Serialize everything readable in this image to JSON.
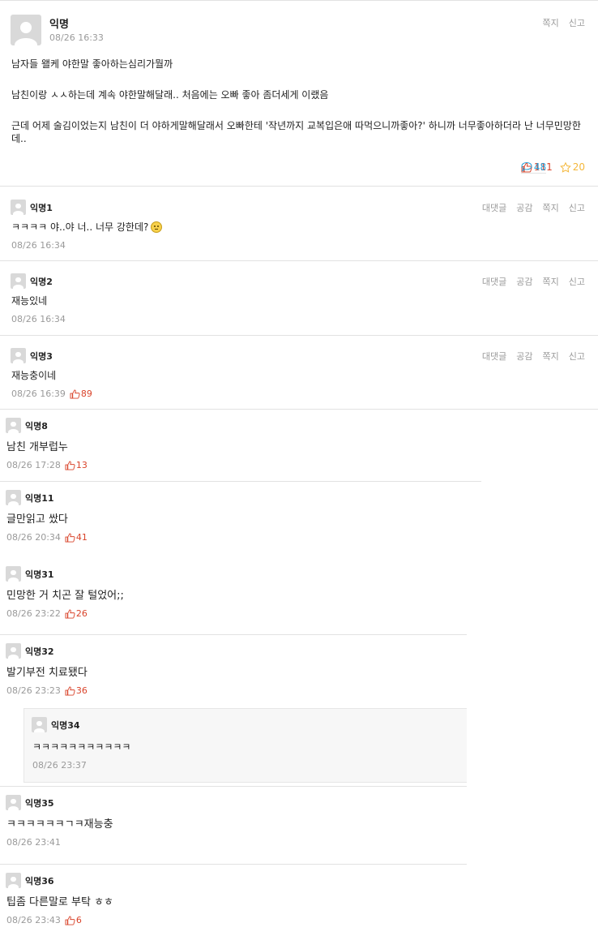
{
  "post": {
    "author": "익명",
    "date": "08/26 16:33",
    "actions": [
      "쪽지",
      "신고"
    ],
    "paragraphs": [
      "남자들 왤케 야한말 좋아하는심리가뭘까",
      "남친이랑 ㅅㅅ하는데 계속 야한말해달래.. 처음에는 오빠 좋아 좀더세게 이랬음",
      "근데 어제 술김이었는지 남친이 더 야하게말해달래서 오빠한테 '작년까지 교복입은애 따먹으니까좋아?' 하니까 너무좋아하더라 난 너무민망한데.."
    ],
    "likes": "111",
    "comments": "48",
    "scraps": "20"
  },
  "comment_actions": [
    "대댓글",
    "공감",
    "쪽지",
    "신고"
  ],
  "comments": [
    {
      "author": "익명1",
      "text": "ㅋㅋㅋㅋ 야..야 너.. 너무 강한데?",
      "date": "08/26 16:34",
      "likes": ""
    },
    {
      "author": "익명2",
      "text": "재능있네",
      "date": "08/26 16:34",
      "likes": ""
    },
    {
      "author": "익명3",
      "text": "재능충이네",
      "date": "08/26 16:39",
      "likes": "89"
    },
    {
      "author": "익명8",
      "text": "남친 개부럽누",
      "date": "08/26 17:28",
      "likes": "13"
    },
    {
      "author": "익명11",
      "text": "글만읽고 쌌다",
      "date": "08/26 20:34",
      "likes": "41"
    },
    {
      "author": "익명31",
      "text": "민망한 거 치곤 잘 털었어;;",
      "date": "08/26 23:22",
      "likes": "26"
    },
    {
      "author": "익명32",
      "text": "발기부전 치료됐다",
      "date": "08/26 23:23",
      "likes": "36"
    },
    {
      "author": "익명35",
      "text": "ㅋㅋㅋㅋㅋㅋㄱㅋ재능충",
      "date": "08/26 23:41",
      "likes": ""
    },
    {
      "author": "익명36",
      "text": "팁좀 다른말로 부탁 ㅎㅎ",
      "date": "08/26 23:43",
      "likes": "6"
    }
  ],
  "reply": {
    "author": "익명34",
    "text": "ㅋㅋㅋㅋㅋㅋㅋㅋㅋㅋㅋ",
    "date": "08/26 23:37"
  },
  "icons": {
    "like": "thumbs-up-icon",
    "comment": "speech-bubble-icon",
    "scrap": "star-icon",
    "avatar": "default-user-avatar",
    "emoji": "smiley-face-emoji"
  },
  "colors": {
    "like": "#d9442b",
    "comment": "#2a9fd6",
    "scrap": "#f4b73a",
    "meta": "#9a9a9a"
  }
}
